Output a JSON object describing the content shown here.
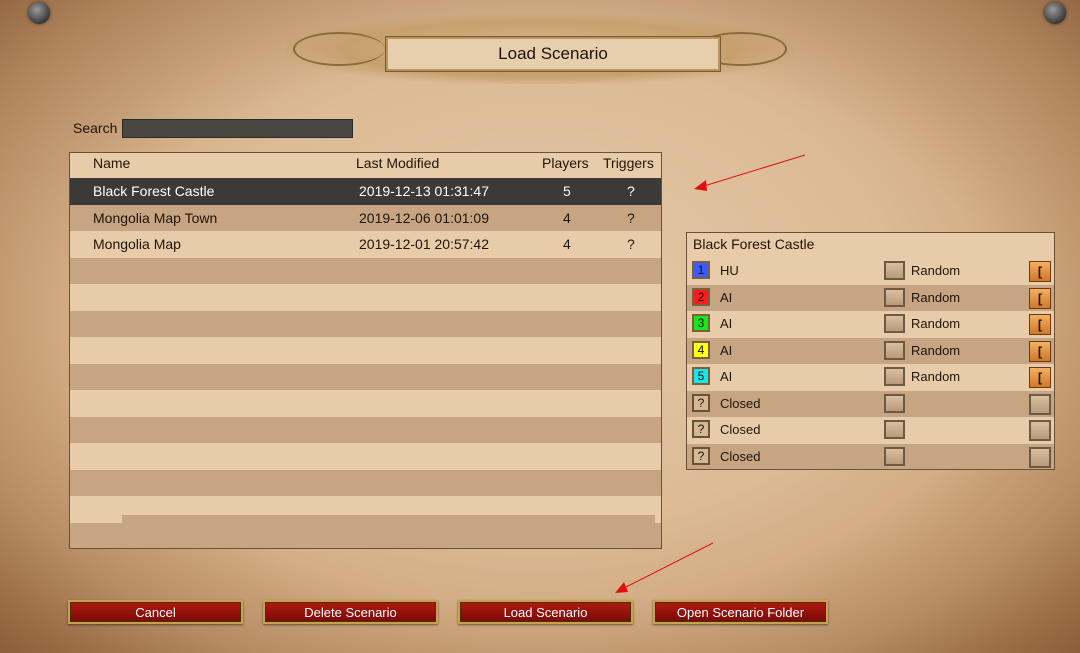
{
  "title": "Load Scenario",
  "search": {
    "label": "Search",
    "value": ""
  },
  "list": {
    "headers": {
      "name": "Name",
      "modified": "Last Modified",
      "players": "Players",
      "triggers": "Triggers"
    },
    "rows": [
      {
        "name": "Black Forest Castle",
        "modified": "2019-12-13 01:31:47",
        "players": "5",
        "triggers": "?"
      },
      {
        "name": "Mongolia Map Town",
        "modified": "2019-12-06 01:01:09",
        "players": "4",
        "triggers": "?"
      },
      {
        "name": "Mongolia Map",
        "modified": "2019-12-01 20:57:42",
        "players": "4",
        "triggers": "?"
      }
    ],
    "selected_index": 0
  },
  "players_panel": {
    "title": "Black Forest Castle",
    "players": [
      {
        "num": "1",
        "color": "#3a5bff",
        "type": "HU",
        "civ": "Random",
        "button": "["
      },
      {
        "num": "2",
        "color": "#ff1a1a",
        "type": "AI",
        "civ": "Random",
        "button": "["
      },
      {
        "num": "3",
        "color": "#19e619",
        "type": "AI",
        "civ": "Random",
        "button": "["
      },
      {
        "num": "4",
        "color": "#ffff19",
        "type": "AI",
        "civ": "Random",
        "button": "["
      },
      {
        "num": "5",
        "color": "#19e6e6",
        "type": "AI",
        "civ": "Random",
        "button": "["
      },
      {
        "num": "?",
        "color": "",
        "type": "Closed",
        "civ": "",
        "button": ""
      },
      {
        "num": "?",
        "color": "",
        "type": "Closed",
        "civ": "",
        "button": ""
      },
      {
        "num": "?",
        "color": "",
        "type": "Closed",
        "civ": "",
        "button": ""
      }
    ]
  },
  "buttons": {
    "cancel": "Cancel",
    "delete": "Delete Scenario",
    "load": "Load Scenario",
    "folder": "Open Scenario Folder"
  },
  "colors": {
    "selected_row": "#3c3a38",
    "button_red": "#9a1008",
    "annotation_arrow": "#e01010"
  }
}
